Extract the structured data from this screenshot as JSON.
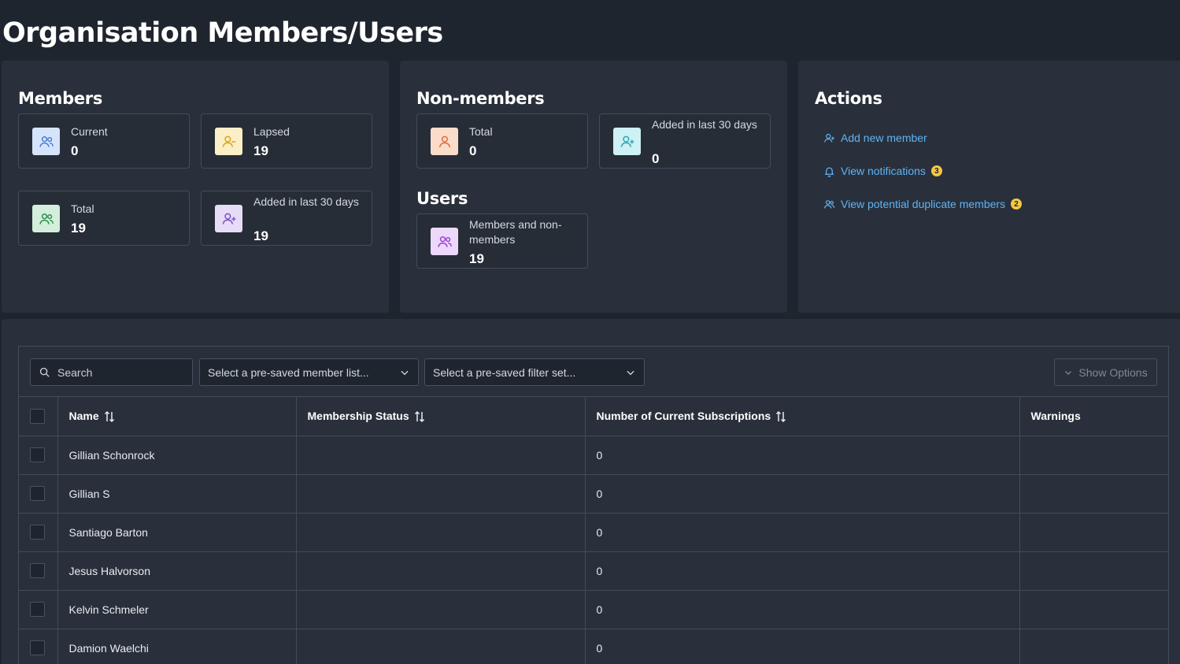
{
  "page": {
    "title": "Organisation Members/Users"
  },
  "members": {
    "heading": "Members",
    "cards": [
      {
        "label": "Current",
        "value": "0",
        "icon": "users-icon",
        "color": "#4a7fd6",
        "bg": "#d6e4fb"
      },
      {
        "label": "Lapsed",
        "value": "19",
        "icon": "user-minus-icon",
        "color": "#d9a514",
        "bg": "#fbefc8"
      },
      {
        "label": "Total",
        "value": "19",
        "icon": "users-icon",
        "color": "#2f8f4f",
        "bg": "#d3efdb"
      },
      {
        "label": "Added in last 30 days",
        "value": "19",
        "icon": "user-plus-icon",
        "color": "#7a54c7",
        "bg": "#e6dcf7"
      }
    ]
  },
  "nonmembers": {
    "heading": "Non-members",
    "cards": [
      {
        "label": "Total",
        "value": "0",
        "icon": "user-icon",
        "color": "#e0703a",
        "bg": "#fbdccb"
      },
      {
        "label": "Added in last 30 days",
        "value": "0",
        "icon": "user-plus-icon",
        "color": "#2fa6b8",
        "bg": "#cdf1f4"
      }
    ]
  },
  "users": {
    "heading": "Users",
    "cards": [
      {
        "label": "Members and non-members",
        "value": "19",
        "icon": "users-icon",
        "color": "#9b3fd6",
        "bg": "#ecd8fa"
      }
    ]
  },
  "actions": {
    "heading": "Actions",
    "links": [
      {
        "label": "Add new member",
        "icon": "user-plus-icon",
        "badge": ""
      },
      {
        "label": "View notifications",
        "icon": "bell-icon",
        "badge": "3"
      },
      {
        "label": "View potential duplicate members",
        "icon": "users-icon",
        "badge": "2"
      }
    ],
    "link_color": "#5fb3f5",
    "badge_color": "#f5c842"
  },
  "toolbar": {
    "search_placeholder": "Search",
    "member_list_placeholder": "Select a pre-saved member list...",
    "filter_set_placeholder": "Select a pre-saved filter set...",
    "options_label": "Show Options"
  },
  "table": {
    "columns": [
      "Name",
      "Membership Status",
      "Number of Current Subscriptions",
      "Warnings"
    ],
    "rows": [
      {
        "name": "Gillian Schonrock",
        "status": "",
        "subscriptions": "0",
        "warnings": ""
      },
      {
        "name": "Gillian S",
        "status": "",
        "subscriptions": "0",
        "warnings": ""
      },
      {
        "name": "Santiago Barton",
        "status": "",
        "subscriptions": "0",
        "warnings": ""
      },
      {
        "name": "Jesus Halvorson",
        "status": "",
        "subscriptions": "0",
        "warnings": ""
      },
      {
        "name": "Kelvin Schmeler",
        "status": "",
        "subscriptions": "0",
        "warnings": ""
      },
      {
        "name": "Damion Waelchi",
        "status": "",
        "subscriptions": "0",
        "warnings": ""
      }
    ]
  }
}
